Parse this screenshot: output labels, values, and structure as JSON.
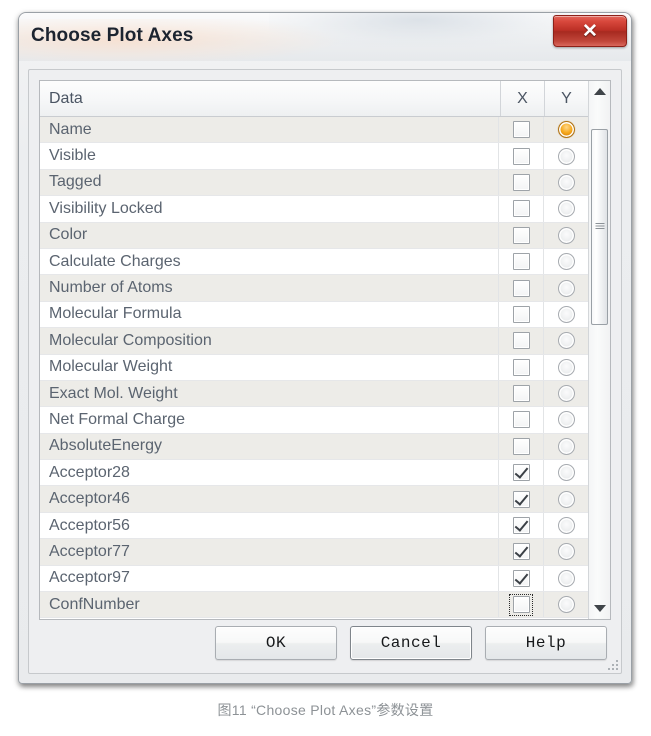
{
  "window": {
    "title": "Choose Plot Axes",
    "close_label": "✕",
    "close_icon": "close-x-icon"
  },
  "table": {
    "headers": {
      "data": "Data",
      "x": "X",
      "y": "Y"
    },
    "rows": [
      {
        "label": "Name",
        "x_checked": false,
        "y_selected": true,
        "focused": false
      },
      {
        "label": "Visible",
        "x_checked": false,
        "y_selected": false,
        "focused": false
      },
      {
        "label": "Tagged",
        "x_checked": false,
        "y_selected": false,
        "focused": false
      },
      {
        "label": "Visibility Locked",
        "x_checked": false,
        "y_selected": false,
        "focused": false
      },
      {
        "label": "Color",
        "x_checked": false,
        "y_selected": false,
        "focused": false
      },
      {
        "label": "Calculate Charges",
        "x_checked": false,
        "y_selected": false,
        "focused": false
      },
      {
        "label": "Number of Atoms",
        "x_checked": false,
        "y_selected": false,
        "focused": false
      },
      {
        "label": "Molecular Formula",
        "x_checked": false,
        "y_selected": false,
        "focused": false
      },
      {
        "label": "Molecular Composition",
        "x_checked": false,
        "y_selected": false,
        "focused": false
      },
      {
        "label": "Molecular Weight",
        "x_checked": false,
        "y_selected": false,
        "focused": false
      },
      {
        "label": "Exact Mol. Weight",
        "x_checked": false,
        "y_selected": false,
        "focused": false
      },
      {
        "label": "Net Formal Charge",
        "x_checked": false,
        "y_selected": false,
        "focused": false
      },
      {
        "label": "AbsoluteEnergy",
        "x_checked": false,
        "y_selected": false,
        "focused": false
      },
      {
        "label": "Acceptor28",
        "x_checked": true,
        "y_selected": false,
        "focused": false
      },
      {
        "label": "Acceptor46",
        "x_checked": true,
        "y_selected": false,
        "focused": false
      },
      {
        "label": "Acceptor56",
        "x_checked": true,
        "y_selected": false,
        "focused": false
      },
      {
        "label": "Acceptor77",
        "x_checked": true,
        "y_selected": false,
        "focused": false
      },
      {
        "label": "Acceptor97",
        "x_checked": true,
        "y_selected": false,
        "focused": false
      },
      {
        "label": "ConfNumber",
        "x_checked": false,
        "y_selected": false,
        "focused": true
      }
    ]
  },
  "scrollbar": {
    "up_icon": "scroll-up-arrow-icon",
    "down_icon": "scroll-down-arrow-icon",
    "thumb_icon": "scrollbar-thumb"
  },
  "buttons": [
    {
      "label": "OK",
      "name": "ok-button",
      "focused": false
    },
    {
      "label": "Cancel",
      "name": "cancel-button",
      "focused": true
    },
    {
      "label": "Help",
      "name": "help-button",
      "focused": false
    }
  ],
  "caption": "图11  “Choose Plot Axes”参数设置",
  "colors": {
    "accent_radio": "#f6a81d",
    "close_button": "#bb2f25",
    "row_alt": "#edece8",
    "text": "#5b6470",
    "caption": "#8d9296"
  }
}
